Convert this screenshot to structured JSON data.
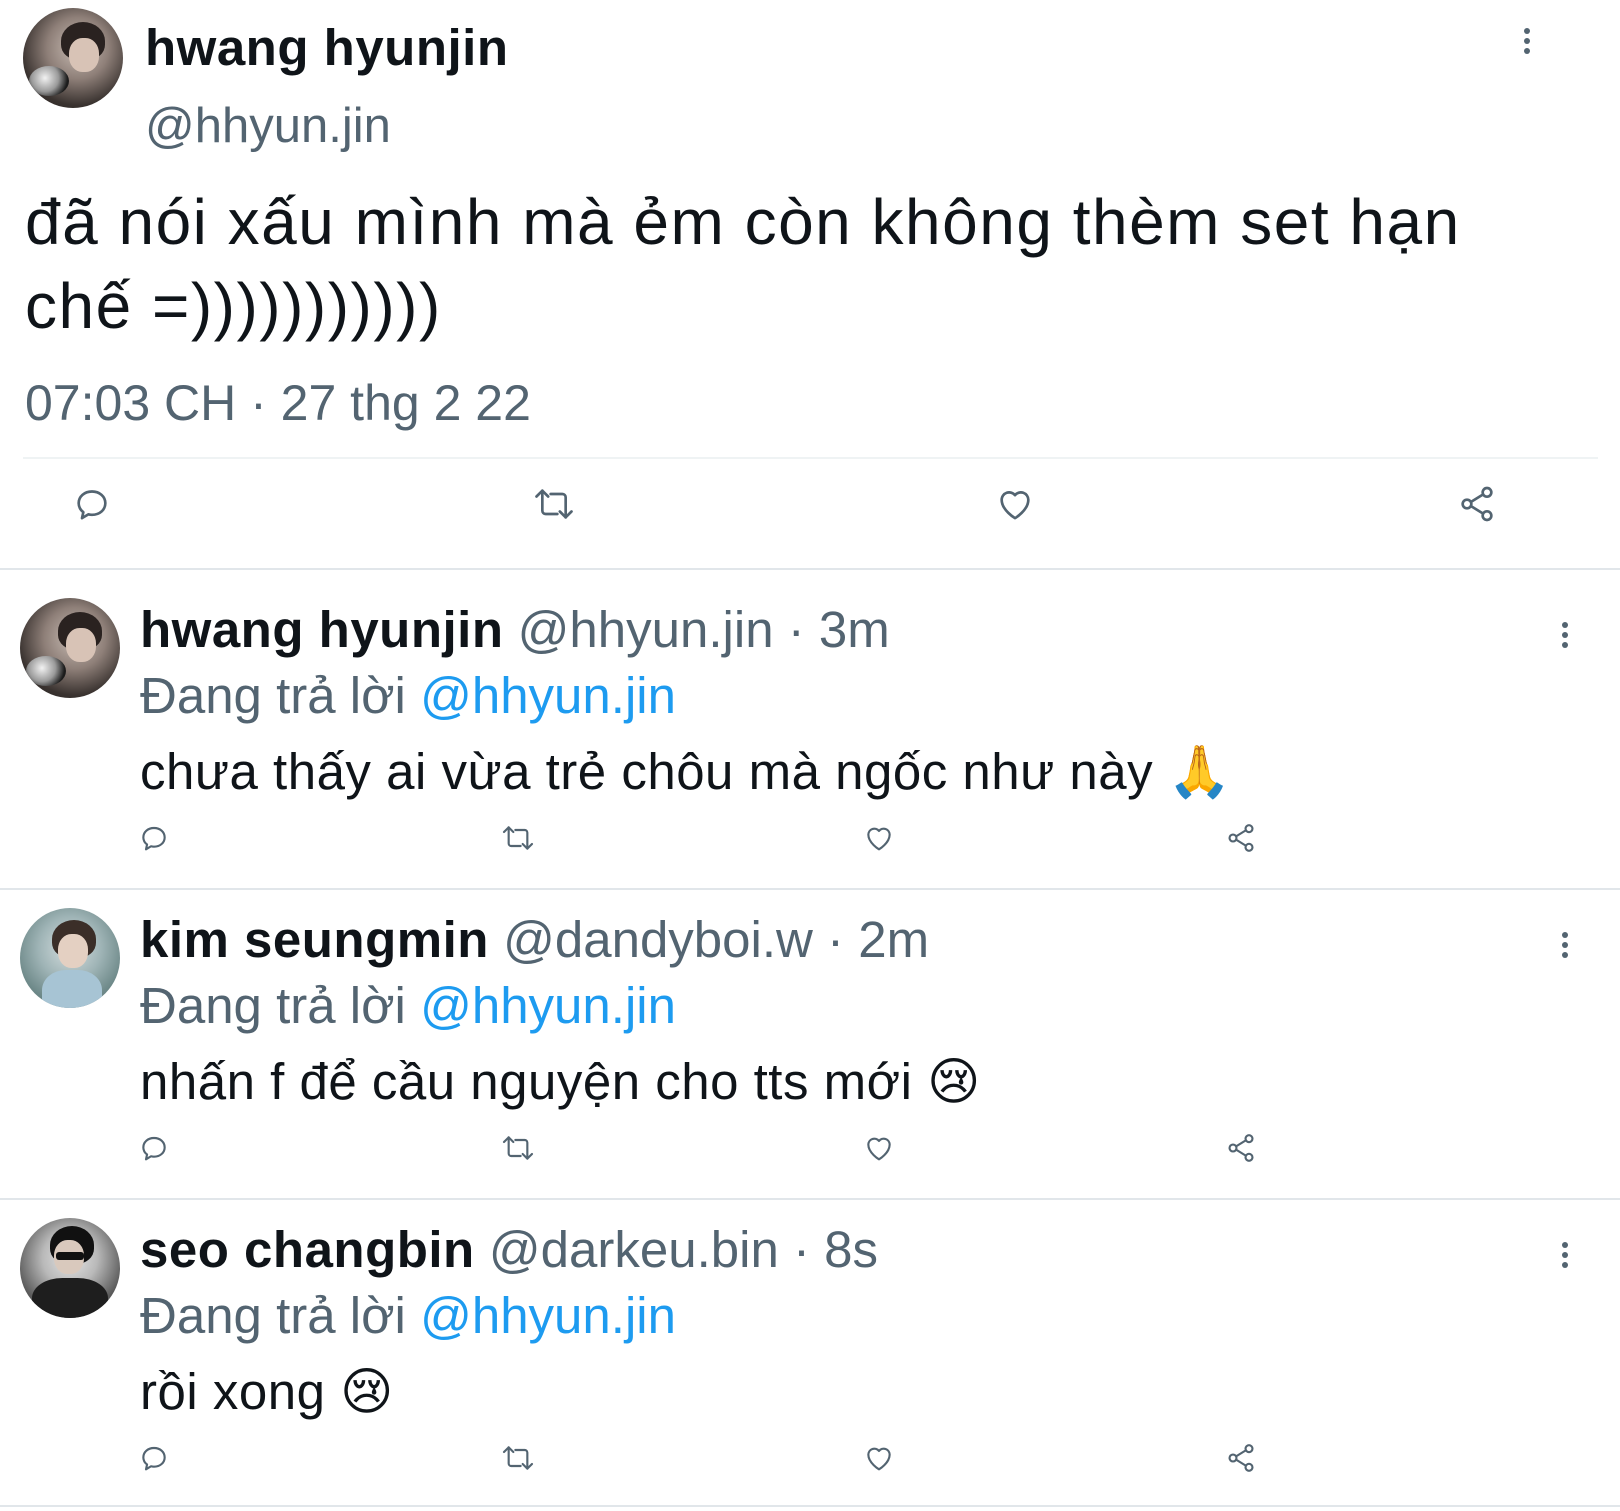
{
  "main_tweet": {
    "name": "hwang hyunjin",
    "handle": "@hhyun.jin",
    "text": "đã nói xấu mình mà ẻm còn không thèm set hạn chế =)))))))))))",
    "timestamp": "07:03 CH · 27 thg 2 22",
    "actions": [
      "reply-icon",
      "retweet-icon",
      "like-icon",
      "share-icon"
    ]
  },
  "replies": [
    {
      "name": "hwang hyunjin",
      "handle": "@hhyun.jin",
      "dot": "·",
      "time": "3m",
      "replying_prefix": "Đang trả lời",
      "replying_to": "@hhyun.jin",
      "text": "chưa thấy ai vừa trẻ chôu mà ngốc như này 🙏"
    },
    {
      "name": "kim seungmin",
      "handle": "@dandyboi.w",
      "dot": "·",
      "time": "2m",
      "replying_prefix": "Đang trả lời",
      "replying_to": "@hhyun.jin",
      "text": "nhấn f để cầu nguyện cho tts mới 😢"
    },
    {
      "name": "seo changbin",
      "handle": "@darkeu.bin",
      "dot": "·",
      "time": "8s",
      "replying_prefix": "Đang trả lời",
      "replying_to": "@hhyun.jin",
      "text": "rồi xong 😢"
    }
  ],
  "colors": {
    "text": "#0f1419",
    "secondary": "#536471",
    "accent": "#1d9bf0",
    "divider": "#e1e6ea"
  }
}
